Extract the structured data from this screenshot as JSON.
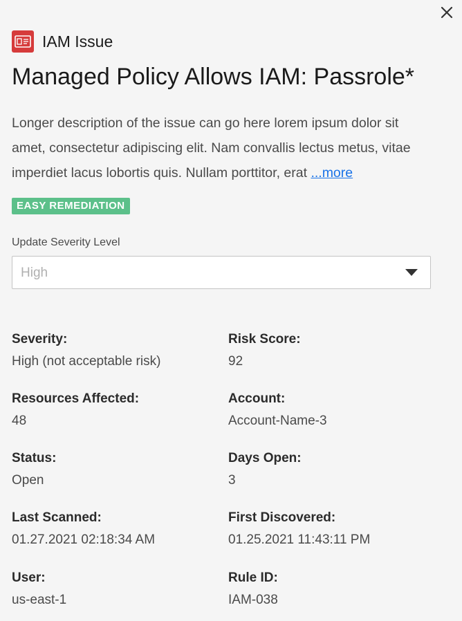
{
  "header": {
    "issue_type": "IAM Issue",
    "title": "Managed Policy Allows IAM: Passrole*",
    "close_icon": "close-icon",
    "issue_icon": "iam-card-icon"
  },
  "description": {
    "text": "Longer description of the issue can go here lorem ipsum dolor sit amet, consectetur adipiscing elit. Nam convallis lectus metus, vitae imperdiet lacus lobortis quis. Nullam porttitor, erat ",
    "more_label": "...more"
  },
  "badge": {
    "label": "EASY REMEDIATION",
    "color": "#5cc08a"
  },
  "severity_select": {
    "label": "Update Severity Level",
    "placeholder": "High"
  },
  "details": {
    "severity": {
      "label": "Severity:",
      "value": "High (not acceptable risk)"
    },
    "risk_score": {
      "label": "Risk Score:",
      "value": "92"
    },
    "resources_affected": {
      "label": "Resources Affected:",
      "value": "48"
    },
    "account": {
      "label": "Account:",
      "value": "Account-Name-3"
    },
    "status": {
      "label": "Status:",
      "value": "Open"
    },
    "days_open": {
      "label": "Days Open:",
      "value": "3"
    },
    "last_scanned": {
      "label": "Last Scanned:",
      "value": "01.27.2021 02:18:34 AM"
    },
    "first_discovered": {
      "label": "First Discovered:",
      "value": "01.25.2021 11:43:11 PM"
    },
    "user": {
      "label": "User:",
      "value": "us-east-1"
    },
    "rule_id": {
      "label": "Rule ID:",
      "value": "IAM-038"
    }
  },
  "colors": {
    "accent_link": "#1a73e8",
    "issue_icon_red": "#d63b3b",
    "background": "#f5f5f5"
  }
}
